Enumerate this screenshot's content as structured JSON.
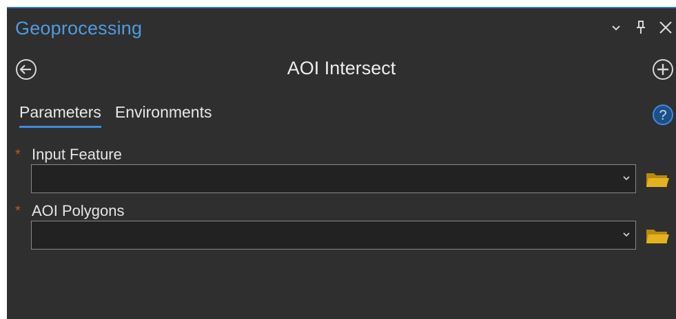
{
  "pane": {
    "title": "Geoprocessing",
    "title_color": "#4f9be0",
    "controls": [
      "chevron-down-icon",
      "pin-icon",
      "close-icon"
    ]
  },
  "tool": {
    "title": "AOI Intersect",
    "back_icon": "back-circle-icon",
    "add_icon": "add-circle-icon"
  },
  "tabs": [
    {
      "label": "Parameters",
      "active": true
    },
    {
      "label": "Environments",
      "active": false
    }
  ],
  "help_icon": "help-circle-icon",
  "parameters": [
    {
      "label": "Input Feature",
      "required": true,
      "value": "",
      "required_mark": "*"
    },
    {
      "label": "AOI Polygons",
      "required": true,
      "value": "",
      "required_mark": "*"
    }
  ],
  "colors": {
    "accent": "#3e8be0",
    "required": "#c1552a",
    "folder": "#e3b21e",
    "panel_bg": "#2f2f2f",
    "field_bg": "#222222"
  }
}
